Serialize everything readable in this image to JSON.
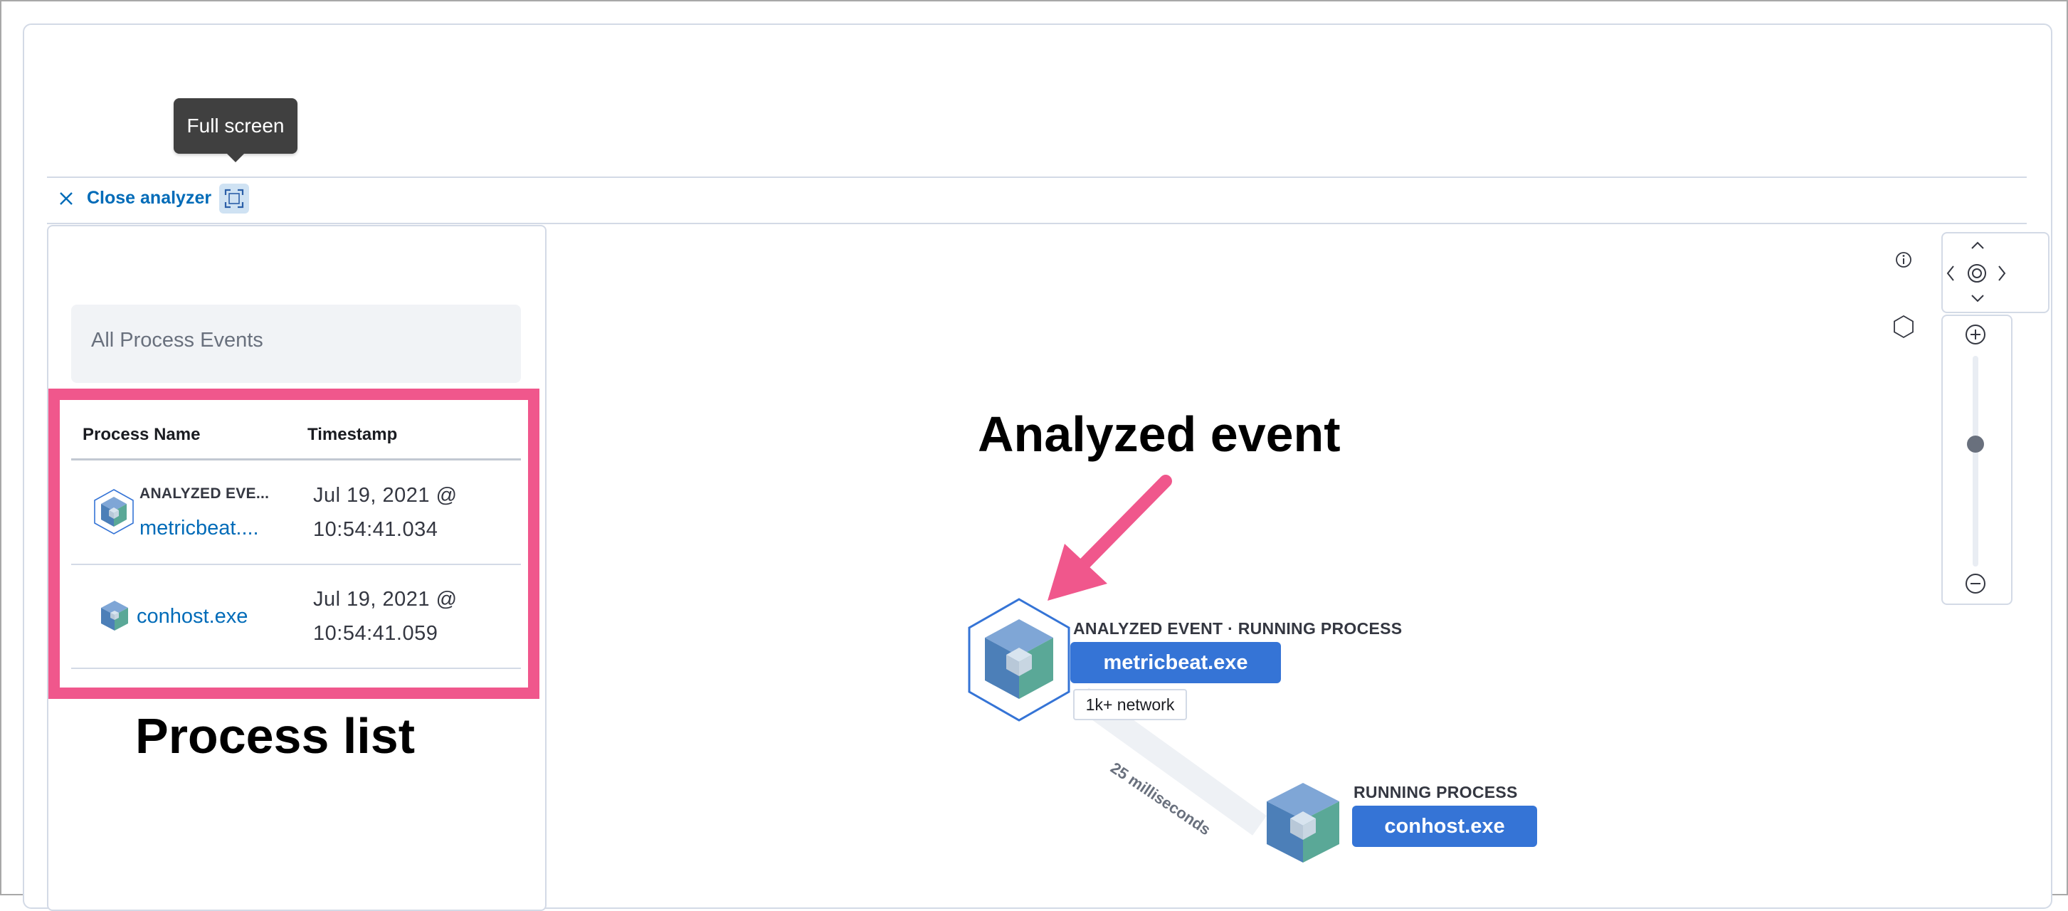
{
  "tooltip": {
    "text": "Full screen"
  },
  "toolbar": {
    "close_label": "Close analyzer"
  },
  "process_list": {
    "search_label": "All Process Events",
    "columns": [
      "Process Name",
      "Timestamp"
    ],
    "rows": [
      {
        "tag": "ANALYZED EVE...",
        "name": "metricbeat....",
        "timestamp_line1": "Jul 19, 2021 @",
        "timestamp_line2": "10:54:41.034"
      },
      {
        "tag": "",
        "name": "conhost.exe",
        "timestamp_line1": "Jul 19, 2021 @",
        "timestamp_line2": "10:54:41.059"
      }
    ]
  },
  "annotations": {
    "process_list": "Process list",
    "analyzed_event": "Analyzed event",
    "highlight_color": "#f0578c"
  },
  "graph": {
    "nodes": [
      {
        "tag": "ANALYZED EVENT · RUNNING PROCESS",
        "name": "metricbeat.exe",
        "badge": "1k+ network"
      },
      {
        "tag": "RUNNING PROCESS",
        "name": "conhost.exe"
      }
    ],
    "edge_label": "25 milliseconds"
  },
  "colors": {
    "link": "#006bb8",
    "pill": "#3574d6",
    "tooltip_bg": "#404040"
  }
}
